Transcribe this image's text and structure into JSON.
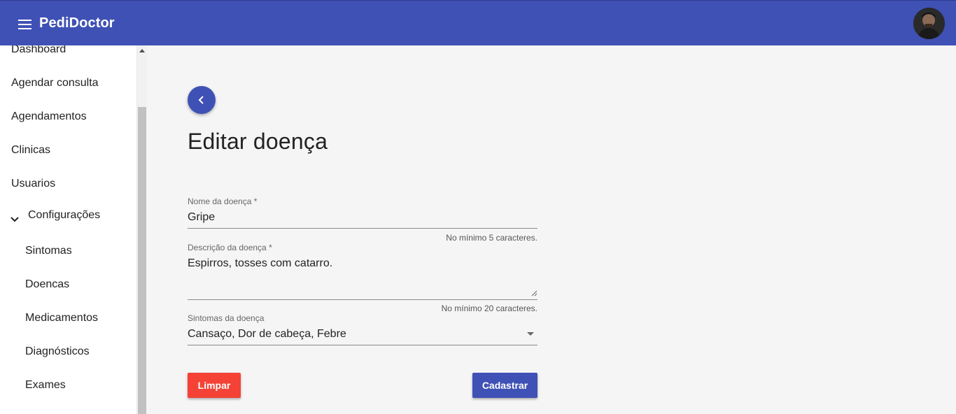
{
  "app": {
    "title": "PediDoctor"
  },
  "sidebar": {
    "items": [
      {
        "label": "Dashboard"
      },
      {
        "label": "Agendar consulta"
      },
      {
        "label": "Agendamentos"
      },
      {
        "label": "Clinicas"
      },
      {
        "label": "Usuarios"
      }
    ],
    "group": {
      "label": "Configurações",
      "expanded": true,
      "items": [
        {
          "label": "Sintomas"
        },
        {
          "label": "Doencas"
        },
        {
          "label": "Medicamentos"
        },
        {
          "label": "Diagnósticos"
        },
        {
          "label": "Exames"
        }
      ]
    }
  },
  "page": {
    "title": "Editar doença"
  },
  "form": {
    "name": {
      "label": "Nome da doença *",
      "value": "Gripe",
      "hint": "No mínimo 5 caracteres."
    },
    "description": {
      "label": "Descrição da doença *",
      "value": "Espirros, tosses com catarro.",
      "hint": "No mínimo 20 caracteres."
    },
    "symptoms": {
      "label": "Sintomas da doença",
      "value": "Cansaço, Dor de cabeça, Febre"
    }
  },
  "buttons": {
    "clear": "Limpar",
    "submit": "Cadastrar"
  },
  "colors": {
    "primary": "#3f51b5",
    "danger": "#f44336",
    "background": "#f5f5f5"
  },
  "icons": {
    "menu": "menu-icon",
    "back": "chevron-left-icon",
    "expand": "chevron-down-icon",
    "dropdown": "dropdown-arrow-icon"
  }
}
